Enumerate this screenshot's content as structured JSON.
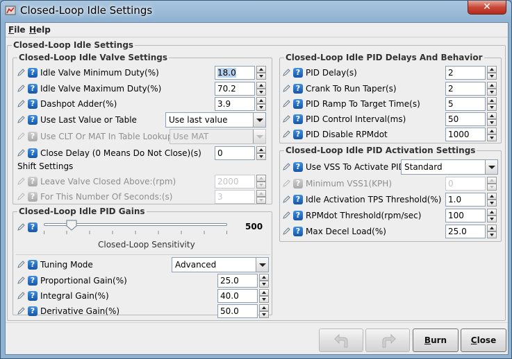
{
  "window": {
    "title": "Closed-Loop Idle Settings",
    "close_glyph": "✕"
  },
  "menu": [
    {
      "label": "File",
      "mnemonic": "F",
      "rest": "ile"
    },
    {
      "label": "Help",
      "mnemonic": "H",
      "rest": "elp"
    }
  ],
  "outer_group": {
    "title": "Closed-Loop Idle Settings"
  },
  "valve": {
    "title": "Closed-Loop Idle Valve Settings",
    "min_duty": {
      "label": "Idle Valve Minimum Duty(%)",
      "value": "18.0"
    },
    "max_duty": {
      "label": "Idle Valve Maximum Duty(%)",
      "value": "70.2"
    },
    "dashpot": {
      "label": "Dashpot Adder(%)",
      "value": "3.9"
    },
    "use_last": {
      "label": "Use Last Value or Table",
      "value": "Use last value"
    },
    "clt_mat": {
      "label": "Use CLT Or MAT In Table Lookup",
      "value": "Use MAT"
    },
    "close_delay": {
      "label": "Close Delay (0 Means Do Not Close)(s)",
      "value": "0"
    },
    "shift_heading": "Shift Settings",
    "leave_closed": {
      "label": "Leave Valve Closed Above:(rpm)",
      "value": "2000"
    },
    "for_seconds": {
      "label": "For This Number Of Seconds:(s)",
      "value": "3"
    }
  },
  "gains": {
    "title": "Closed-Loop Idle PID Gains",
    "sensitivity": {
      "caption": "Closed-Loop Sensitivity",
      "value": "500",
      "fraction": 0.13
    },
    "tuning_mode": {
      "label": "Tuning Mode",
      "value": "Advanced"
    },
    "proportional": {
      "label": "Proportional Gain(%)",
      "value": "25.0"
    },
    "integral": {
      "label": "Integral Gain(%)",
      "value": "40.0"
    },
    "derivative": {
      "label": "Derivative Gain(%)",
      "value": "50.0"
    }
  },
  "delays": {
    "title": "Closed-Loop Idle PID Delays And Behavior",
    "pid_delay": {
      "label": "PID Delay(s)",
      "value": "2"
    },
    "crank_taper": {
      "label": "Crank To Run Taper(s)",
      "value": "2"
    },
    "ramp": {
      "label": "PID Ramp To Target Time(s)",
      "value": "5"
    },
    "interval": {
      "label": "PID Control Interval(ms)",
      "value": "50"
    },
    "disable_rpmdot": {
      "label": "PID Disable RPMdot",
      "value": "1000"
    }
  },
  "activation": {
    "title": "Closed-Loop Idle PID Activation Settings",
    "use_vss": {
      "label": "Use VSS To Activate PID",
      "value": "Standard"
    },
    "min_vss": {
      "label": "Minimum VSS1(KPH)",
      "value": "0"
    },
    "tps_threshold": {
      "label": "Idle Activation TPS Threshold(%)",
      "value": "1.0"
    },
    "rpmdot_threshold": {
      "label": "RPMdot Threshold(rpm/sec)",
      "value": "100"
    },
    "max_decel": {
      "label": "Max Decel Load(%)",
      "value": "25.0"
    }
  },
  "buttons": {
    "burn": {
      "mnemonic": "B",
      "rest": "urn"
    },
    "close": {
      "mnemonic": "C",
      "rest": "lose"
    }
  },
  "icons": {
    "help": "?"
  }
}
